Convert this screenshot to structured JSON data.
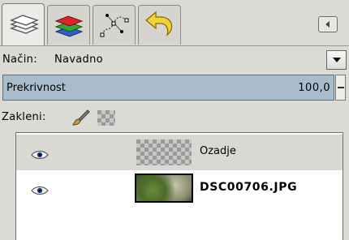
{
  "tabs": [
    {
      "icon": "layers-icon",
      "active": true
    },
    {
      "icon": "channels-icon",
      "active": false
    },
    {
      "icon": "paths-icon",
      "active": false
    },
    {
      "icon": "undo-history-icon",
      "active": false
    }
  ],
  "mode": {
    "label": "Način:",
    "value": "Navadno"
  },
  "opacity": {
    "label": "Prekrivnost",
    "value": "100,0"
  },
  "lock": {
    "label": "Zakleni:"
  },
  "layers": [
    {
      "name": "Ozadje",
      "visible": true,
      "thumbnail": "transparent-checker",
      "selected": true
    },
    {
      "name": "DSC00706.JPG",
      "visible": true,
      "thumbnail": "photo",
      "selected": false
    }
  ],
  "colors": {
    "opacity_fill": "#a9bccb",
    "selected_row": "#dad8d3"
  }
}
